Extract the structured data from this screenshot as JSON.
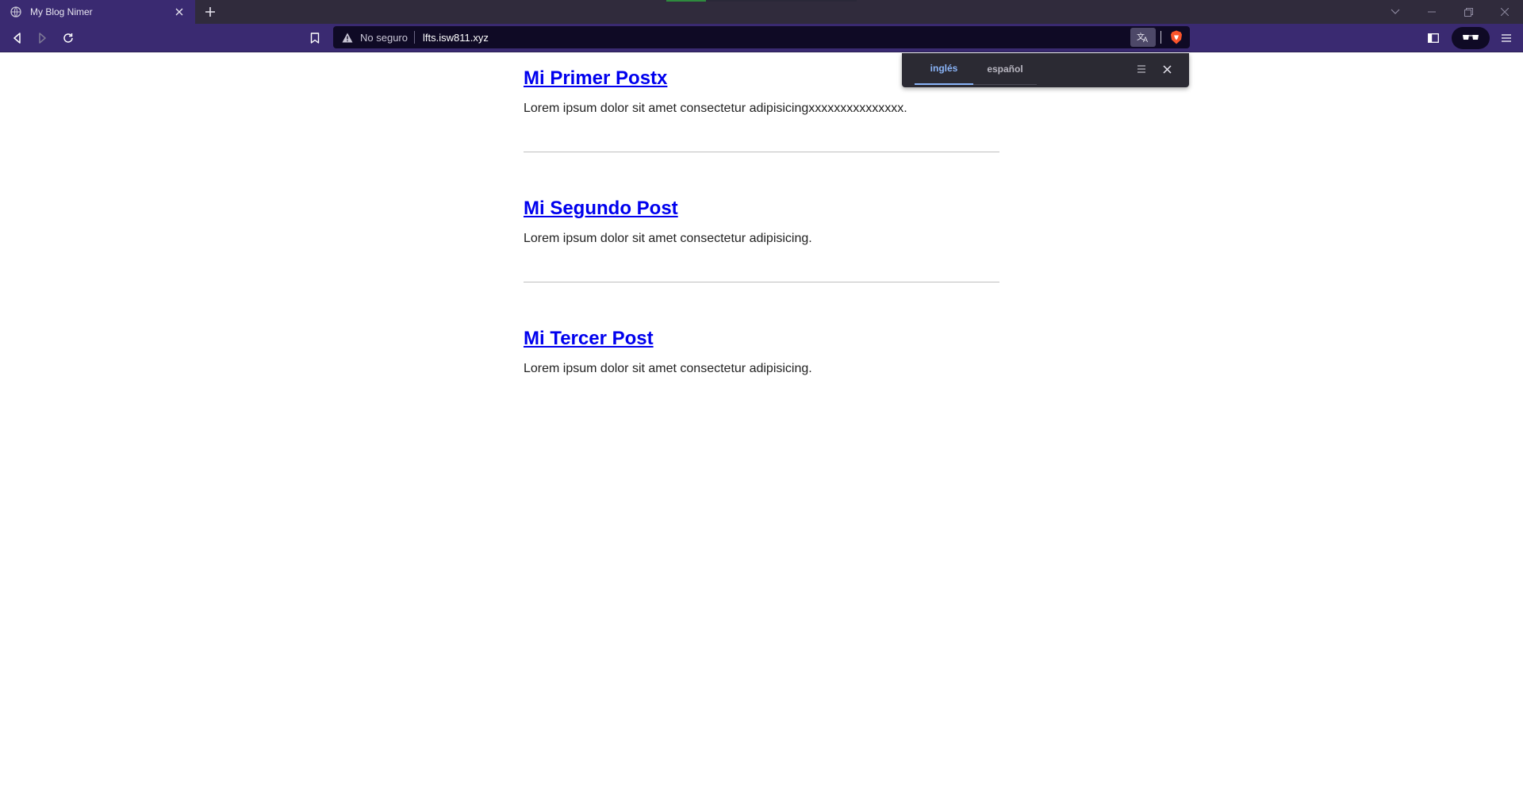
{
  "browser": {
    "tab": {
      "title": "My Blog Nimer"
    },
    "address_bar": {
      "security_label": "No seguro",
      "url": "lfts.isw811.xyz"
    }
  },
  "translate_popup": {
    "tabs": [
      {
        "label": "inglés",
        "active": true
      },
      {
        "label": "español",
        "active": false
      }
    ]
  },
  "posts": [
    {
      "title": "Mi Primer Postx",
      "body": "Lorem ipsum dolor sit amet consectetur adipisicingxxxxxxxxxxxxxxx."
    },
    {
      "title": "Mi Segundo Post",
      "body": "Lorem ipsum dolor sit amet consectetur adipisicing."
    },
    {
      "title": "Mi Tercer Post",
      "body": "Lorem ipsum dolor sit amet consectetur adipisicing."
    }
  ],
  "colors": {
    "chrome_bar": "#3a2a71",
    "tab_strip": "#302b3c",
    "link": "#0000ee",
    "translate_active": "#8ab4f8"
  }
}
